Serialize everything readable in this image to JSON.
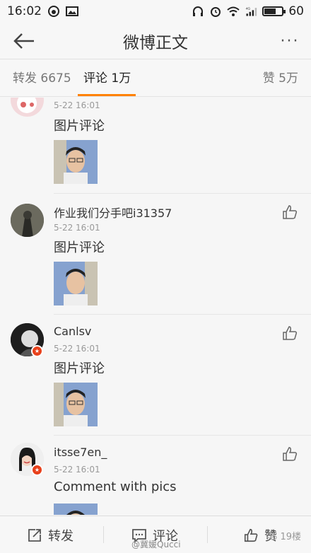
{
  "status_bar": {
    "time": "16:02",
    "battery": "60",
    "battery_level": 0.6,
    "network": "4G"
  },
  "title_bar": {
    "title": "微博正文",
    "more": "···"
  },
  "tabs": {
    "repost": "转发 6675",
    "comment": "评论 1万",
    "like": "赞 5万"
  },
  "comments": [
    {
      "username": "",
      "time": "5-22 16:01",
      "text": "图片评论"
    },
    {
      "username": "作业我们分手吧i31357",
      "time": "5-22 16:01",
      "text": "图片评论"
    },
    {
      "username": "Canlsv",
      "time": "5-22 16:01",
      "text": "图片评论"
    },
    {
      "username": "itsse7en_",
      "time": "5-22 16:01",
      "text": "Comment with pics"
    }
  ],
  "bottom_bar": {
    "repost": "转发",
    "comment": "评论",
    "like": "赞",
    "floor": "19楼"
  },
  "watermark": "@冀媛Qucci",
  "colors": {
    "accent": "#ff8200",
    "badge": "#e8401a",
    "background": "#f6f6f6"
  }
}
